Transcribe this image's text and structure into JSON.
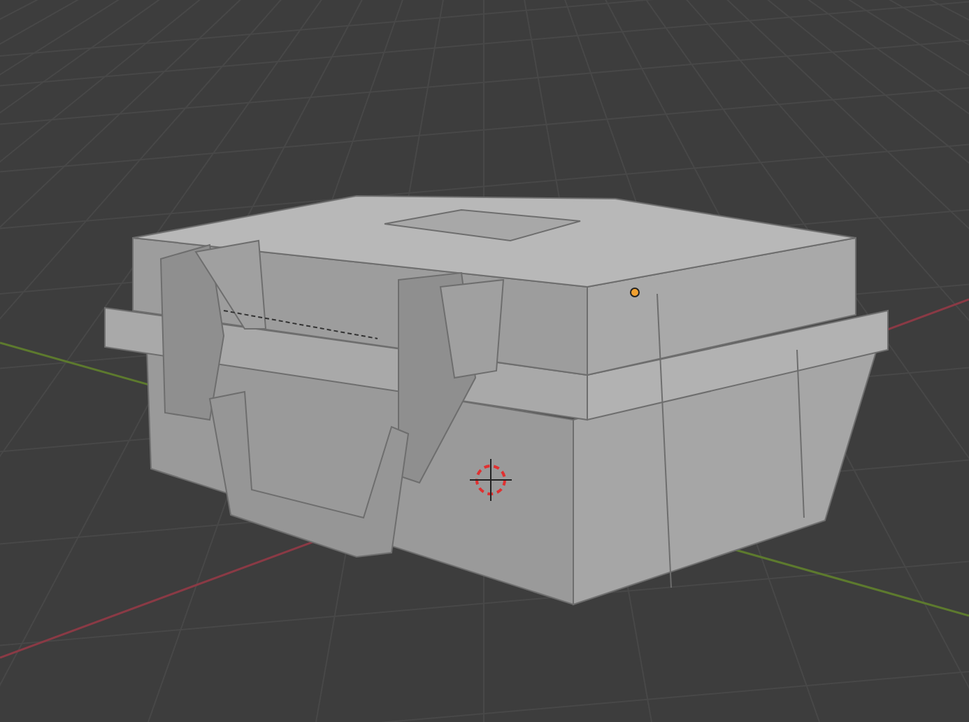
{
  "viewport": {
    "grid": true,
    "x_axis": true,
    "y_axis": true,
    "model": true,
    "cursor_3d": true,
    "origin": true
  }
}
